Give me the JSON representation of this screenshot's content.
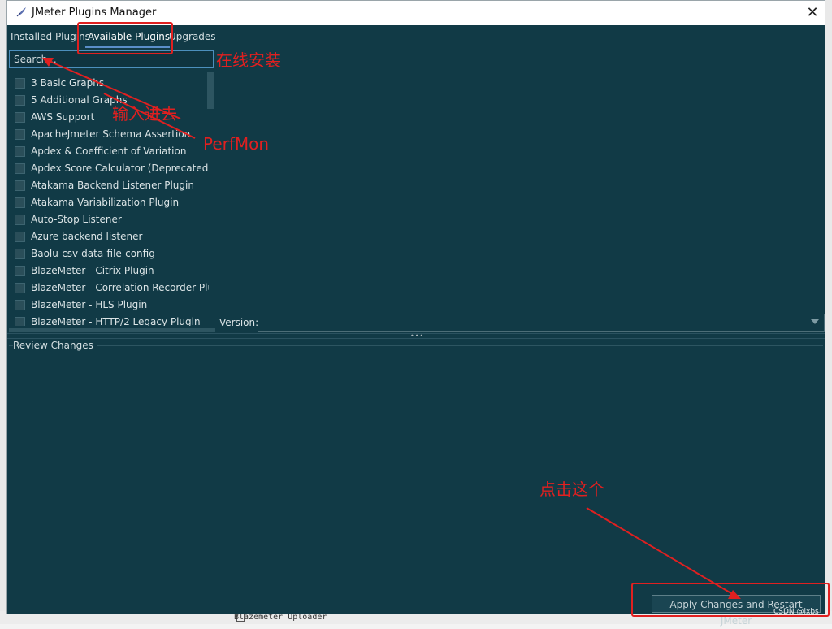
{
  "window": {
    "title": "JMeter Plugins Manager",
    "close_glyph": "✕"
  },
  "tabs": [
    {
      "label": "Installed Plugins",
      "active": false
    },
    {
      "label": "Available Plugins",
      "active": true
    },
    {
      "label": "Upgrades",
      "active": false
    }
  ],
  "search": {
    "placeholder": "Search...",
    "value": ""
  },
  "plugins": [
    {
      "label": "3 Basic Graphs",
      "checked": false
    },
    {
      "label": "5 Additional Graphs",
      "checked": false
    },
    {
      "label": "AWS Support",
      "checked": false
    },
    {
      "label": "ApacheJmeter Schema Assertion",
      "checked": false
    },
    {
      "label": "Apdex & Coefficient of Variation",
      "checked": false
    },
    {
      "label": "Apdex Score Calculator (Deprecated)",
      "checked": false
    },
    {
      "label": "Atakama Backend Listener Plugin",
      "checked": false
    },
    {
      "label": "Atakama Variabilization Plugin",
      "checked": false
    },
    {
      "label": "Auto-Stop Listener",
      "checked": false
    },
    {
      "label": "Azure backend listener",
      "checked": false
    },
    {
      "label": "Baolu-csv-data-file-config",
      "checked": false
    },
    {
      "label": "BlazeMeter - Citrix Plugin",
      "checked": false
    },
    {
      "label": "BlazeMeter - Correlation Recorder Plugin",
      "checked": false
    },
    {
      "label": "BlazeMeter - HLS Plugin",
      "checked": false
    },
    {
      "label": "BlazeMeter - HTTP/2 Legacy Plugin",
      "checked": false
    }
  ],
  "version": {
    "label": "Version:",
    "value": ""
  },
  "review": {
    "title": "Review Changes"
  },
  "apply_button": {
    "label": "Apply Changes and Restart JMeter"
  },
  "annotations": {
    "online_install": "在线安装",
    "type_in": "输入进去",
    "perfmon": "PerfMon",
    "click_this": "点击这个",
    "color": "#e02020"
  },
  "watermark": "CSDN @lxbs",
  "background_page": {
    "bottom_row_text": "Blazemeter Uploader"
  },
  "colors": {
    "dialog_bg": "#113a46",
    "accent": "#5a8ec9",
    "text": "#dbe4e6"
  }
}
